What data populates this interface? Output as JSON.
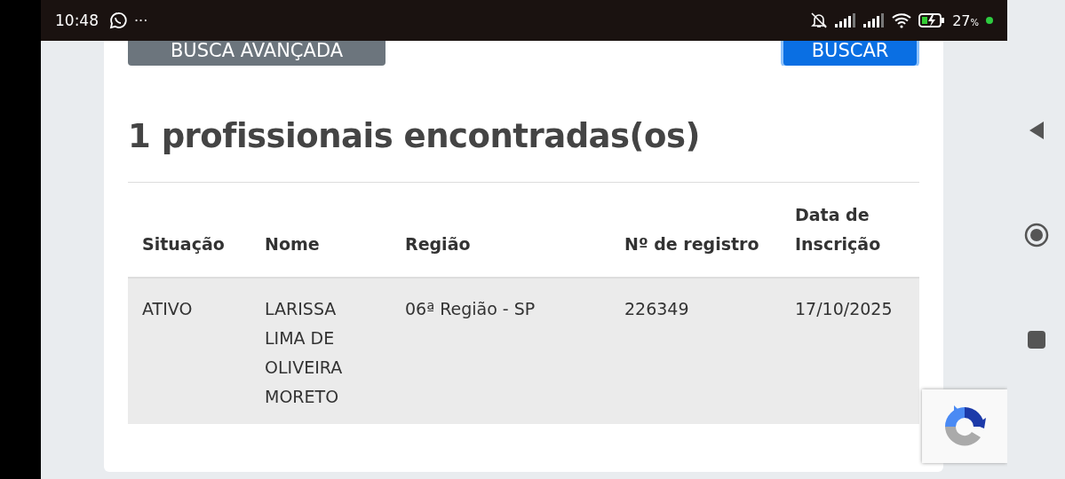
{
  "status_bar": {
    "time": "10:48",
    "more": "···",
    "battery": "27",
    "battery_unit": "%"
  },
  "buttons": [
    {
      "label": "BUSCA AVANÇADA",
      "kind": "secondary"
    },
    {
      "label": "BUSCAR",
      "kind": "primary"
    }
  ],
  "results_heading": "1 profissionais encontradas(os)",
  "table": {
    "columns": [
      "Situação",
      "Nome",
      "Região",
      "Nº de registro",
      "Data de Inscrição"
    ],
    "rows": [
      {
        "cells": [
          "ATIVO",
          "LARISSA LIMA DE OLIVEIRA MORETO",
          "06ª Região - SP",
          "226349",
          "17/10/2025"
        ]
      }
    ]
  }
}
